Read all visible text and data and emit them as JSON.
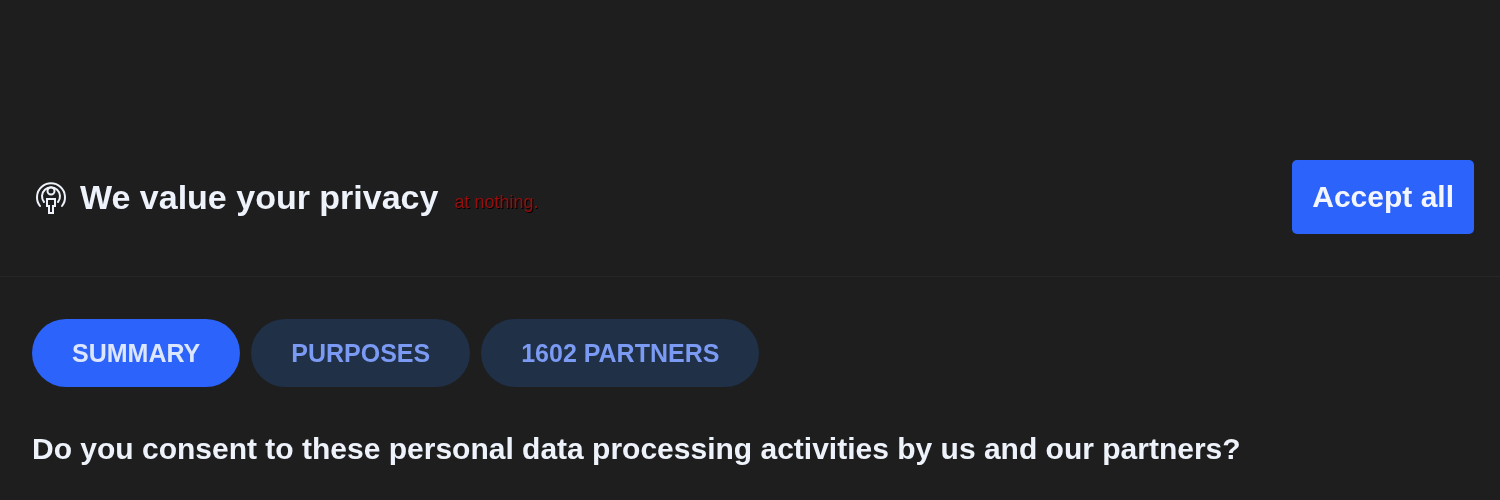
{
  "header": {
    "title": "We value your privacy",
    "annotation": "at nothing.",
    "accept_button": "Accept all"
  },
  "tabs": [
    {
      "label": "SUMMARY",
      "selected": true
    },
    {
      "label": "PURPOSES",
      "selected": false
    },
    {
      "label": "1602 PARTNERS",
      "selected": false
    }
  ],
  "question": "Do you consent to these personal data processing activities by us and our partners?"
}
